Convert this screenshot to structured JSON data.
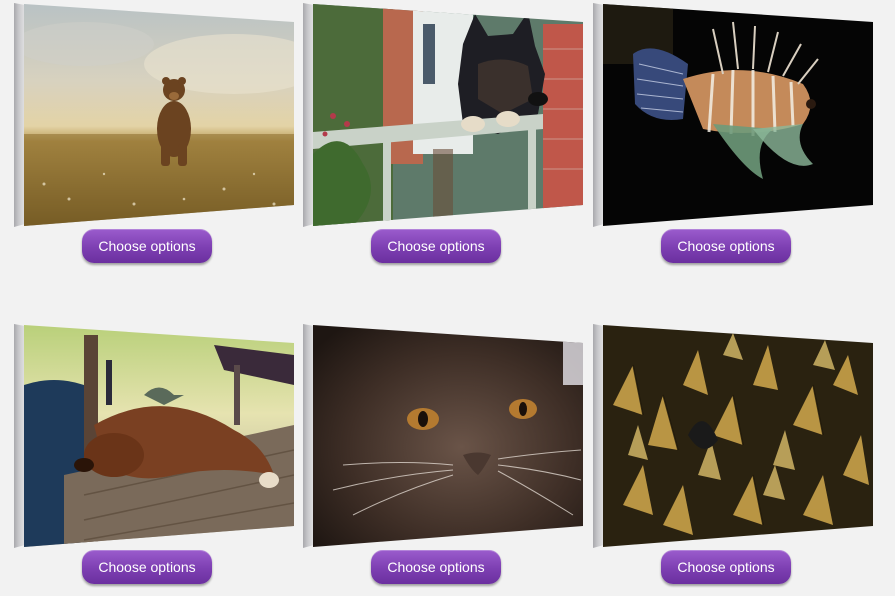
{
  "products": [
    {
      "image": "bear-in-meadow",
      "button_label": "Choose options"
    },
    {
      "image": "dog-at-gate",
      "button_label": "Choose options"
    },
    {
      "image": "lionfish",
      "button_label": "Choose options"
    },
    {
      "image": "sleeping-dog",
      "button_label": "Choose options"
    },
    {
      "image": "brown-kitten",
      "button_label": "Choose options"
    },
    {
      "image": "butterflies",
      "button_label": "Choose options"
    }
  ],
  "colors": {
    "page_background": "#f2f2f2",
    "button_purple": "#7d3fb2",
    "button_text": "#ffffff"
  }
}
